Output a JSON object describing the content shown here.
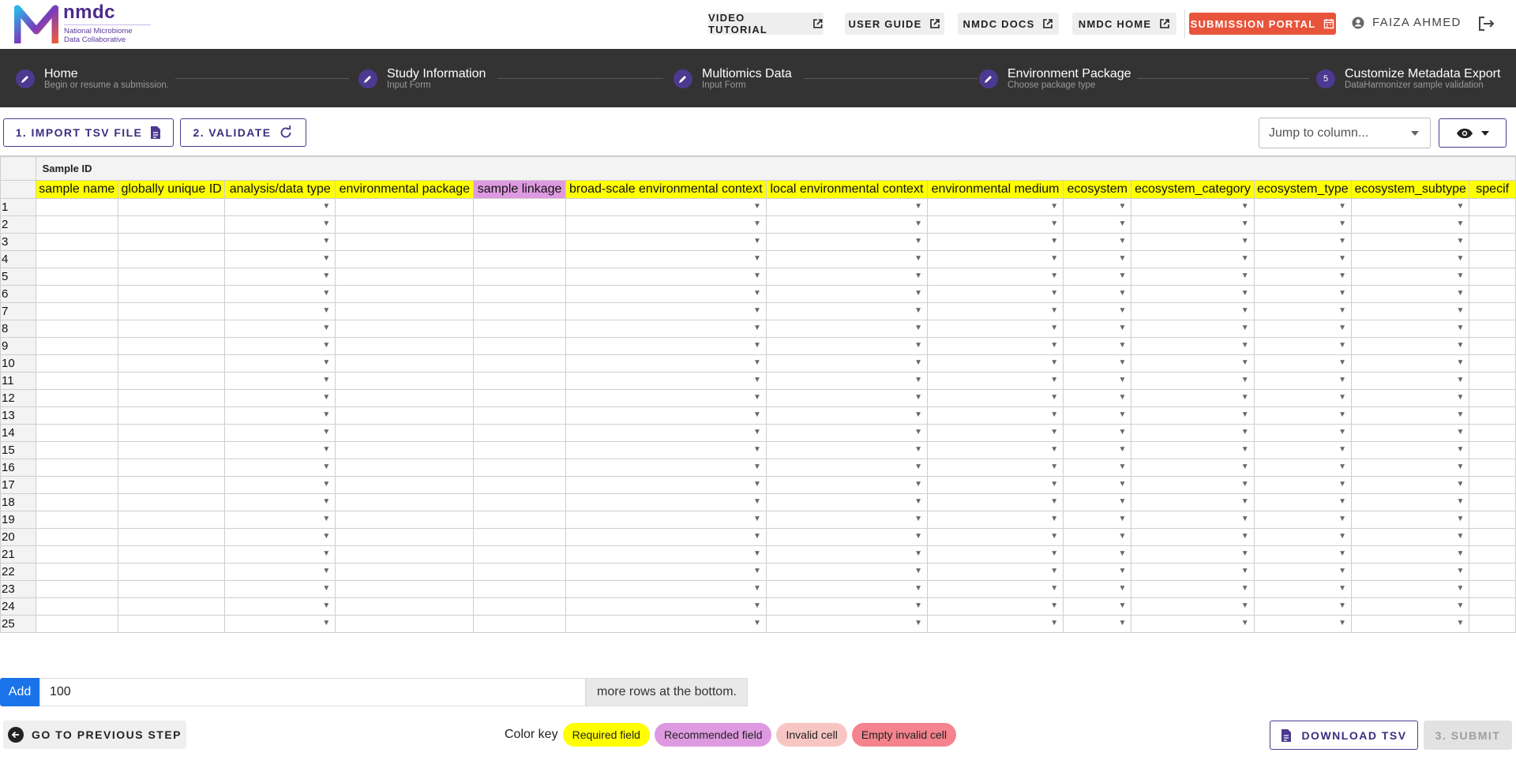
{
  "brand": {
    "name": "nmdc",
    "subtitle_line1": "National Microbiome",
    "subtitle_line2": "Data Collaborative"
  },
  "topnav": {
    "video_tutorial": "VIDEO TUTORIAL",
    "user_guide": "USER GUIDE",
    "nmdc_docs": "NMDC DOCS",
    "nmdc_home": "NMDC HOME",
    "submission_portal": "SUBMISSION PORTAL",
    "user_name": "FAIZA AHMED"
  },
  "steps": [
    {
      "title": "Home",
      "subtitle": "Begin or resume a submission.",
      "icon": "pencil-icon"
    },
    {
      "title": "Study Information",
      "subtitle": "Input Form",
      "icon": "pencil-icon"
    },
    {
      "title": "Multiomics Data",
      "subtitle": "Input Form",
      "icon": "pencil-icon"
    },
    {
      "title": "Environment Package",
      "subtitle": "Choose package type",
      "icon": "pencil-icon"
    },
    {
      "title": "Customize Metadata Export",
      "subtitle": "DataHarmonizer sample validation",
      "number": "5"
    }
  ],
  "toolbar": {
    "import_label": "1. IMPORT TSV FILE",
    "validate_label": "2. VALIDATE",
    "jump_placeholder": "Jump to column..."
  },
  "grid": {
    "group_label": "Sample ID",
    "columns": [
      {
        "label": "sample name",
        "kind": "required",
        "dropdown": false
      },
      {
        "label": "globally unique ID",
        "kind": "required",
        "dropdown": false
      },
      {
        "label": "analysis/data type",
        "kind": "required",
        "dropdown": true
      },
      {
        "label": "environmental package",
        "kind": "required",
        "dropdown": false
      },
      {
        "label": "sample linkage",
        "kind": "recommended",
        "dropdown": false
      },
      {
        "label": "broad-scale environmental context",
        "kind": "required",
        "dropdown": true
      },
      {
        "label": "local environmental context",
        "kind": "required",
        "dropdown": true
      },
      {
        "label": "environmental medium",
        "kind": "required",
        "dropdown": true
      },
      {
        "label": "ecosystem",
        "kind": "required",
        "dropdown": true
      },
      {
        "label": "ecosystem_category",
        "kind": "required",
        "dropdown": true
      },
      {
        "label": "ecosystem_type",
        "kind": "required",
        "dropdown": true
      },
      {
        "label": "ecosystem_subtype",
        "kind": "required",
        "dropdown": true
      },
      {
        "label": "specif",
        "kind": "required",
        "dropdown": false
      }
    ],
    "row_numbers": [
      "1",
      "2",
      "3",
      "4",
      "5",
      "6",
      "7",
      "8",
      "9",
      "10",
      "11",
      "12",
      "13",
      "14",
      "15",
      "16",
      "17",
      "18",
      "19",
      "20",
      "21",
      "22",
      "23",
      "24",
      "25"
    ]
  },
  "add_rows": {
    "button": "Add",
    "value": "100",
    "suffix": "more rows at the bottom."
  },
  "footer": {
    "prev_label": "GO TO PREVIOUS STEP",
    "color_key_label": "Color key",
    "key_required": "Required field",
    "key_recommended": "Recommended field",
    "key_invalid": "Invalid cell",
    "key_empty_invalid": "Empty invalid cell",
    "download_label": "DOWNLOAD TSV",
    "submit_label": "3. SUBMIT"
  },
  "colors": {
    "brand_purple": "#4c3a91",
    "portal_orange": "#e8543b",
    "required_yellow": "#ffff00",
    "recommended_purple": "#dd9ae0",
    "invalid_pink": "#f7c6c3",
    "empty_invalid_pink": "#f4838e",
    "add_blue": "#1a73e8",
    "stepper_bg": "#333333"
  }
}
